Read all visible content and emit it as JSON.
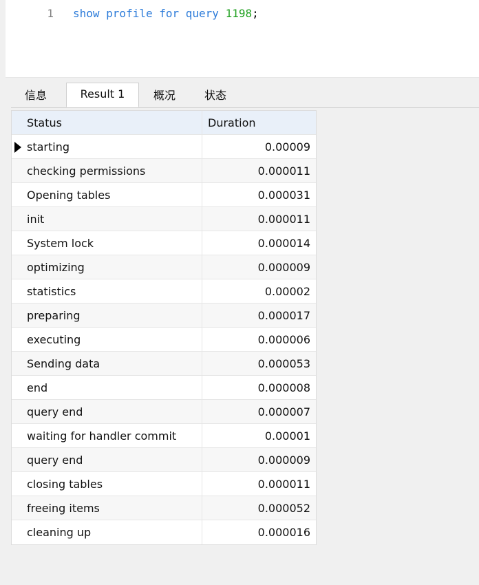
{
  "editor": {
    "line_number": "1",
    "code_prefix": "show profile for query ",
    "code_number": "1198",
    "code_suffix": ";"
  },
  "tabs": [
    {
      "label": "信息",
      "active": false
    },
    {
      "label": "Result 1",
      "active": true
    },
    {
      "label": "概况",
      "active": false
    },
    {
      "label": "状态",
      "active": false
    }
  ],
  "grid": {
    "columns": [
      "Status",
      "Duration"
    ],
    "rows": [
      {
        "status": "starting",
        "duration": "0.00009"
      },
      {
        "status": "checking permissions",
        "duration": "0.000011"
      },
      {
        "status": "Opening tables",
        "duration": "0.000031"
      },
      {
        "status": "init",
        "duration": "0.000011"
      },
      {
        "status": "System lock",
        "duration": "0.000014"
      },
      {
        "status": "optimizing",
        "duration": "0.000009"
      },
      {
        "status": "statistics",
        "duration": "0.00002"
      },
      {
        "status": "preparing",
        "duration": "0.000017"
      },
      {
        "status": "executing",
        "duration": "0.000006"
      },
      {
        "status": "Sending data",
        "duration": "0.000053"
      },
      {
        "status": "end",
        "duration": "0.000008"
      },
      {
        "status": "query end",
        "duration": "0.000007"
      },
      {
        "status": "waiting for handler commit",
        "duration": "0.00001"
      },
      {
        "status": "query end",
        "duration": "0.000009"
      },
      {
        "status": "closing tables",
        "duration": "0.000011"
      },
      {
        "status": "freeing items",
        "duration": "0.000052"
      },
      {
        "status": "cleaning up",
        "duration": "0.000016"
      }
    ]
  }
}
